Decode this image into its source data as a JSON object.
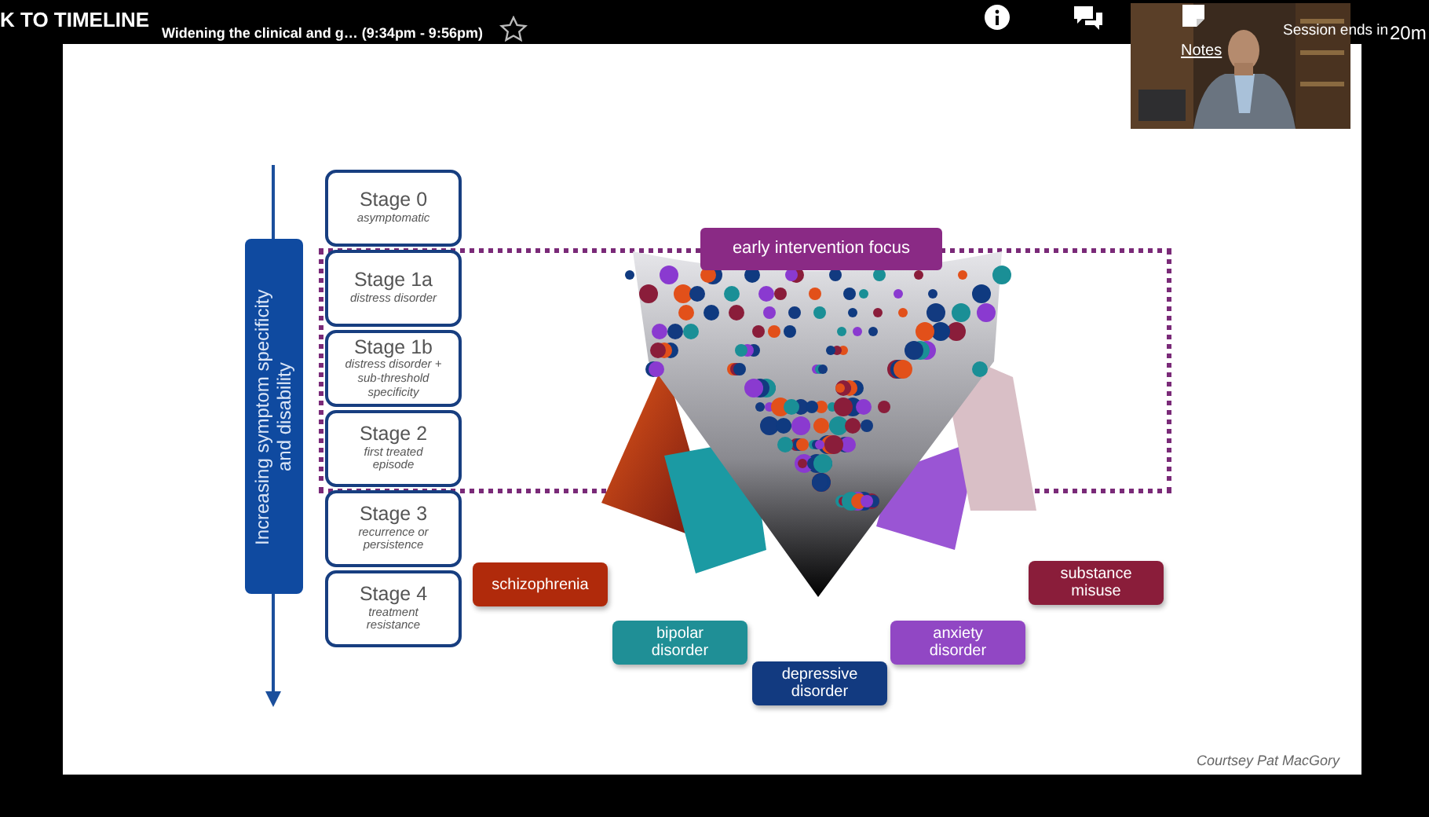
{
  "top_bar": {
    "back_link": "K TO TIMELINE",
    "session_title": "Widening the clinical and g… (9:34pm - 9:56pm)",
    "notes_label": "Notes",
    "timer_label": "Session ends in",
    "timer_value": "20m"
  },
  "slide": {
    "axis_label": "Increasing symptom specificity and disability",
    "stages": [
      {
        "title": "Stage 0",
        "description": "asymptomatic"
      },
      {
        "title": "Stage 1a",
        "description": "distress disorder"
      },
      {
        "title": "Stage 1b",
        "description": "distress disorder + sub-threshold specificity"
      },
      {
        "title": "Stage 2",
        "description": "first treated episode"
      },
      {
        "title": "Stage 3",
        "description": "recurrence or persistence"
      },
      {
        "title": "Stage 4",
        "description": "treatment resistance"
      }
    ],
    "focus_label": "early intervention focus",
    "disorders": [
      {
        "label": "schizophrenia",
        "color": "#b02a0b"
      },
      {
        "label": "bipolar disorder",
        "color": "#1f8f96"
      },
      {
        "label": "depressive disorder",
        "color": "#123a80"
      },
      {
        "label": "anxiety disorder",
        "color": "#9147c4"
      },
      {
        "label": "substance misuse",
        "color": "#8a1d3a"
      }
    ],
    "credit": "Courtsey Pat MacGory"
  }
}
